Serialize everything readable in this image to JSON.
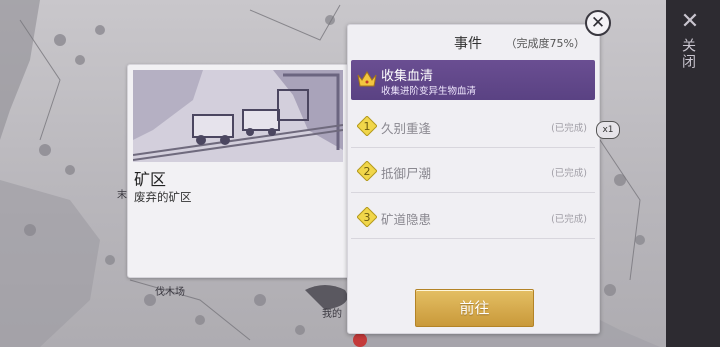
{
  "side": {
    "close_icon": "✕",
    "close_label": "关闭"
  },
  "map": {
    "labels": {
      "lumber": "伐木场",
      "mine": "我的",
      "edge": "末"
    }
  },
  "info": {
    "title": "矿区",
    "description": "废弃的矿区",
    "image_icon": "mine-cart-illustration"
  },
  "events": {
    "title": "事件",
    "progress": "（完成度75%）",
    "selected": {
      "title": "收集血清",
      "subtitle": "收集进阶变异生物血清",
      "icon": "crown-icon"
    },
    "items": [
      {
        "num": "1",
        "label": "久别重逢",
        "status": "(已完成)"
      },
      {
        "num": "2",
        "label": "抵御尸潮",
        "status": "(已完成)"
      },
      {
        "num": "3",
        "label": "矿道隐患",
        "status": "(已完成)"
      }
    ],
    "go_label": "前往",
    "close_glyph": "✕",
    "x1_badge": "x1"
  },
  "colors": {
    "accent_purple": "#5e4589",
    "gold": "#d4aa4d",
    "badge_yellow": "#f1d64a"
  }
}
